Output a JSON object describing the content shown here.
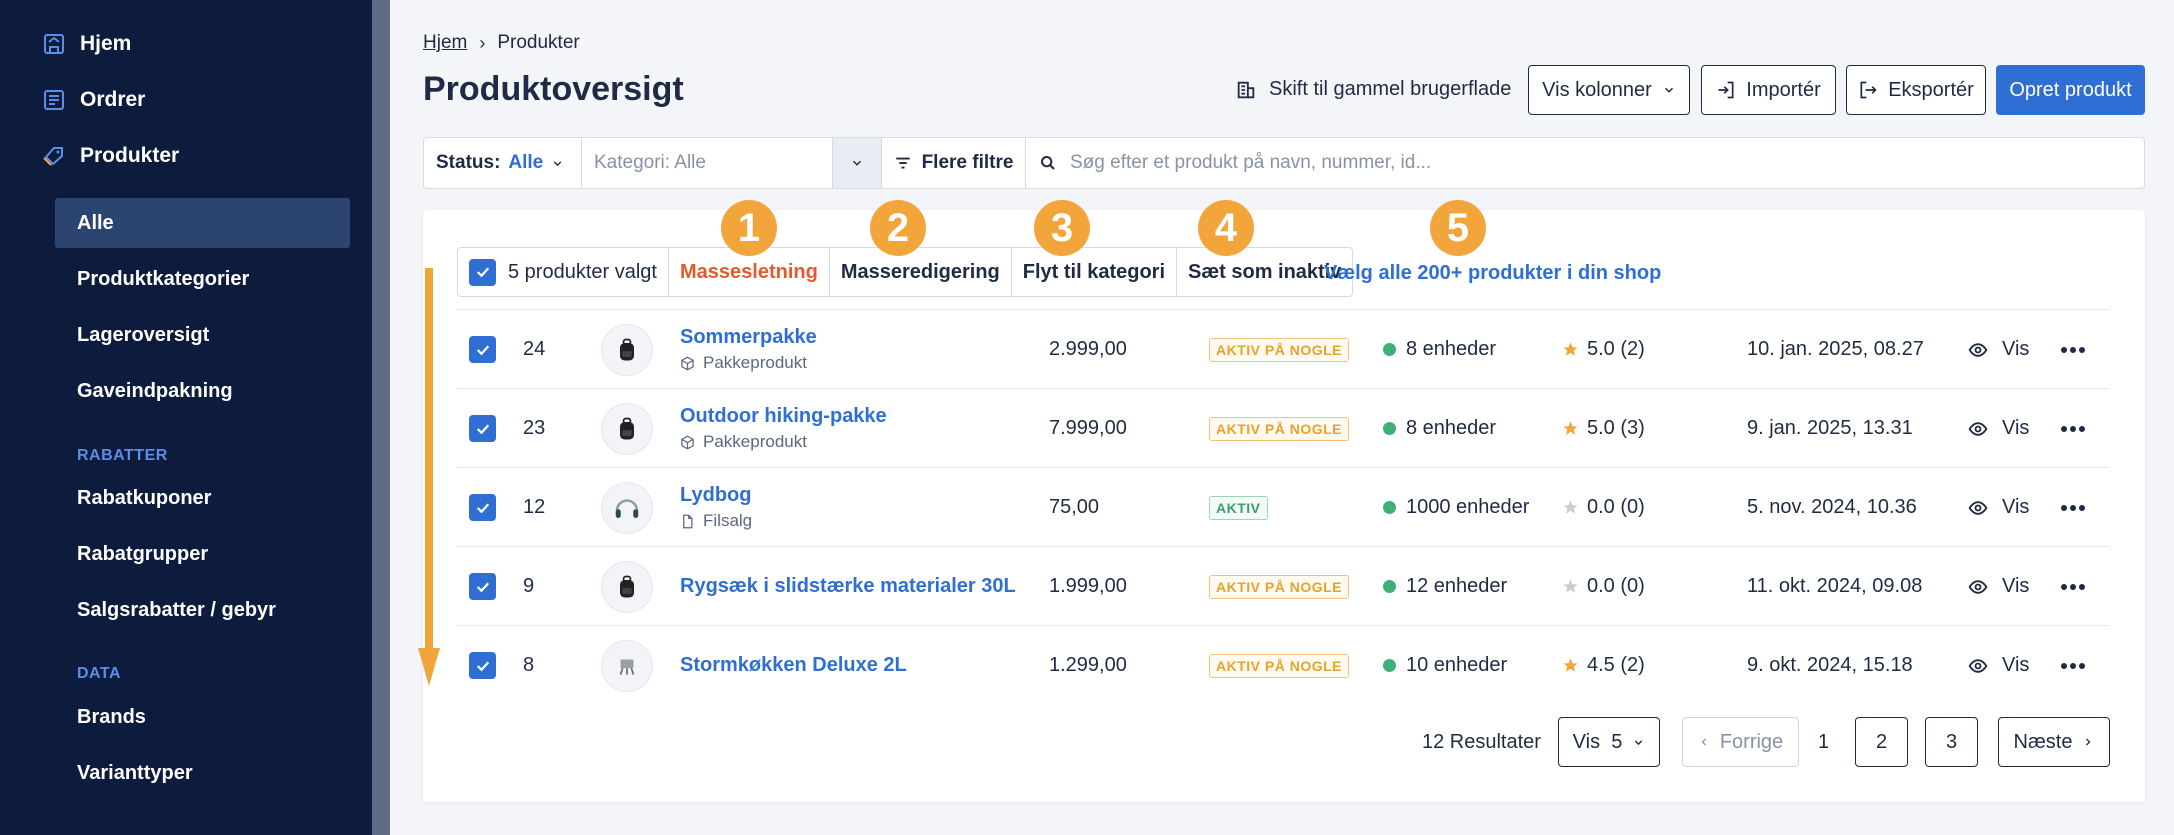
{
  "sidebar": {
    "top_items": [
      {
        "label": "Hjem",
        "icon": "home-icon"
      },
      {
        "label": "Ordrer",
        "icon": "orders-icon"
      },
      {
        "label": "Produkter",
        "icon": "tag-icon"
      }
    ],
    "product_items": [
      "Alle",
      "Produktkategorier",
      "Lageroversigt",
      "Gaveindpakning"
    ],
    "rabatter_title": "RABATTER",
    "rabatter_items": [
      "Rabatkuponer",
      "Rabatgrupper",
      "Salgsrabatter / gebyr"
    ],
    "data_title": "DATA",
    "data_items": [
      "Brands",
      "Varianttyper"
    ]
  },
  "breadcrumb": {
    "home": "Hjem",
    "current": "Produkter"
  },
  "page_title": "Produktoversigt",
  "header": {
    "switch_ui": "Skift til gammel brugerflade",
    "columns": "Vis kolonner",
    "import": "Importér",
    "export": "Eksportér",
    "create": "Opret produkt"
  },
  "filters": {
    "status_label": "Status:",
    "status_value": "Alle",
    "category_placeholder": "Kategori: Alle",
    "more_filters": "Flere filtre",
    "search_placeholder": "Søg efter et produkt på navn, nummer, id..."
  },
  "bulk": {
    "selected": "5 produkter valgt",
    "delete": "Massesletning",
    "edit": "Masseredigering",
    "move": "Flyt til kategori",
    "inactive": "Sæt som inaktiv",
    "select_all": "Vælg alle 200+ produkter i din shop"
  },
  "callouts": [
    "1",
    "2",
    "3",
    "4",
    "5"
  ],
  "accent_color": "#f2a53a",
  "products": [
    {
      "id": "24",
      "name": "Sommerpakke",
      "type": "Pakkeprodukt",
      "type_icon": "package-icon",
      "price": "2.999,00",
      "status": "AKTIV PÅ NOGLE",
      "status_kind": "partial",
      "stock": "8 enheder",
      "rating": "5.0 (2)",
      "rated": true,
      "date": "10. jan. 2025, 08.27",
      "view": "Vis",
      "thumb": "backpack-icon"
    },
    {
      "id": "23",
      "name": "Outdoor hiking-pakke",
      "type": "Pakkeprodukt",
      "type_icon": "package-icon",
      "price": "7.999,00",
      "status": "AKTIV PÅ NOGLE",
      "status_kind": "partial",
      "stock": "8 enheder",
      "rating": "5.0 (3)",
      "rated": true,
      "date": "9. jan. 2025, 13.31",
      "view": "Vis",
      "thumb": "backpack-icon"
    },
    {
      "id": "12",
      "name": "Lydbog",
      "type": "Filsalg",
      "type_icon": "file-icon",
      "price": "75,00",
      "status": "AKTIV",
      "status_kind": "active",
      "stock": "1000 enheder",
      "rating": "0.0 (0)",
      "rated": false,
      "date": "5. nov. 2024, 10.36",
      "view": "Vis",
      "thumb": "headphones-icon"
    },
    {
      "id": "9",
      "name": "Rygsæk i slidstærke materialer 30L",
      "type": "",
      "type_icon": "",
      "price": "1.999,00",
      "status": "AKTIV PÅ NOGLE",
      "status_kind": "partial",
      "stock": "12 enheder",
      "rating": "0.0 (0)",
      "rated": false,
      "date": "11. okt. 2024, 09.08",
      "view": "Vis",
      "thumb": "backpack-icon"
    },
    {
      "id": "8",
      "name": "Stormkøkken Deluxe 2L",
      "type": "",
      "type_icon": "",
      "price": "1.299,00",
      "status": "AKTIV PÅ NOGLE",
      "status_kind": "partial",
      "stock": "10 enheder",
      "rating": "4.5 (2)",
      "rated": true,
      "date": "9. okt. 2024, 15.18",
      "view": "Vis",
      "thumb": "stove-icon"
    }
  ],
  "pagination": {
    "results": "12 Resultater",
    "per_page": "Vis  5",
    "prev": "Forrige",
    "current": "1",
    "pages": [
      "2",
      "3"
    ],
    "next": "Næste"
  }
}
